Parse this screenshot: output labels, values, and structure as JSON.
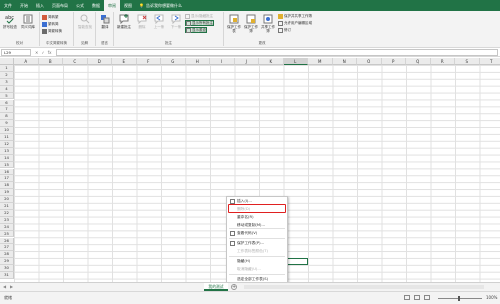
{
  "menu": {
    "tabs": [
      "文件",
      "开始",
      "插入",
      "页面布局",
      "公式",
      "数据",
      "审阅",
      "视图"
    ],
    "active_tab": "审阅",
    "tell_me": "告诉我你想要做什么"
  },
  "ribbon": {
    "proofing": {
      "label": "校对",
      "spelling": "拼写检查",
      "thesaurus": "同义词库"
    },
    "chinese_conversion": {
      "label": "中文简繁转换",
      "to_traditional": "简转繁",
      "to_simplified": "繁转简",
      "convert": "简繁转换"
    },
    "insights": {
      "label": "见解",
      "smart_lookup": "智能查找"
    },
    "language": {
      "label": "语言",
      "translate": "翻译"
    },
    "comments": {
      "label": "批注",
      "new_comment": "新建批注",
      "delete": "删除",
      "previous": "上一条",
      "next": "下一条",
      "show_hide": "显示/隐藏批注",
      "show_all": "显示所有批注",
      "show_ink": "显示墨迹"
    },
    "changes": {
      "label": "更改",
      "protect_sheet": "保护工作表",
      "protect_workbook": "保护工作簿",
      "share_workbook": "共享工作簿",
      "protect_share": "保护并共享工作簿",
      "allow_edit": "允许用户编辑区域",
      "track_changes": "修订"
    }
  },
  "formula_bar": {
    "name_box": "L29",
    "fx": "fx"
  },
  "grid": {
    "columns": [
      "A",
      "B",
      "C",
      "D",
      "E",
      "F",
      "G",
      "H",
      "I",
      "J",
      "K",
      "L",
      "M",
      "N",
      "O",
      "P",
      "Q",
      "R",
      "S",
      "T"
    ],
    "active_column": "L",
    "rows": [
      "1",
      "2",
      "3",
      "4",
      "5",
      "6",
      "7",
      "8",
      "9",
      "10",
      "11",
      "12",
      "13",
      "14",
      "15",
      "16",
      "17",
      "18",
      "19",
      "20",
      "21",
      "22",
      "23",
      "24",
      "25",
      "26",
      "27",
      "28",
      "29",
      "30",
      "31"
    ]
  },
  "context_menu": {
    "items": [
      {
        "label": "插入(I)...",
        "icon": "insert-icon",
        "enabled": true
      },
      {
        "label": "删除(D)",
        "icon": "delete-icon",
        "enabled": false
      },
      {
        "label": "重命名(R)",
        "icon": "rename-icon",
        "enabled": true
      },
      {
        "label": "移动或复制(M)...",
        "icon": "move-copy-icon",
        "enabled": true
      },
      {
        "label": "查看代码(V)",
        "icon": "code-icon",
        "enabled": true
      },
      {
        "label": "保护工作表(P)...",
        "icon": "protect-icon",
        "enabled": true
      },
      {
        "label": "工作表标签颜色(T)",
        "icon": "tab-color-icon",
        "enabled": false
      },
      {
        "label": "隐藏(H)",
        "icon": "hide-icon",
        "enabled": true
      },
      {
        "label": "取消隐藏(U)...",
        "icon": "unhide-icon",
        "enabled": false
      },
      {
        "label": "选定全部工作表(S)",
        "icon": "select-all-icon",
        "enabled": true
      }
    ]
  },
  "sheet_tabs": {
    "active": "我的测试",
    "add": "+"
  },
  "status_bar": {
    "status": "就绪",
    "zoom": "100%"
  },
  "colors": {
    "accent": "#217346",
    "highlight_box": "#e02020"
  }
}
